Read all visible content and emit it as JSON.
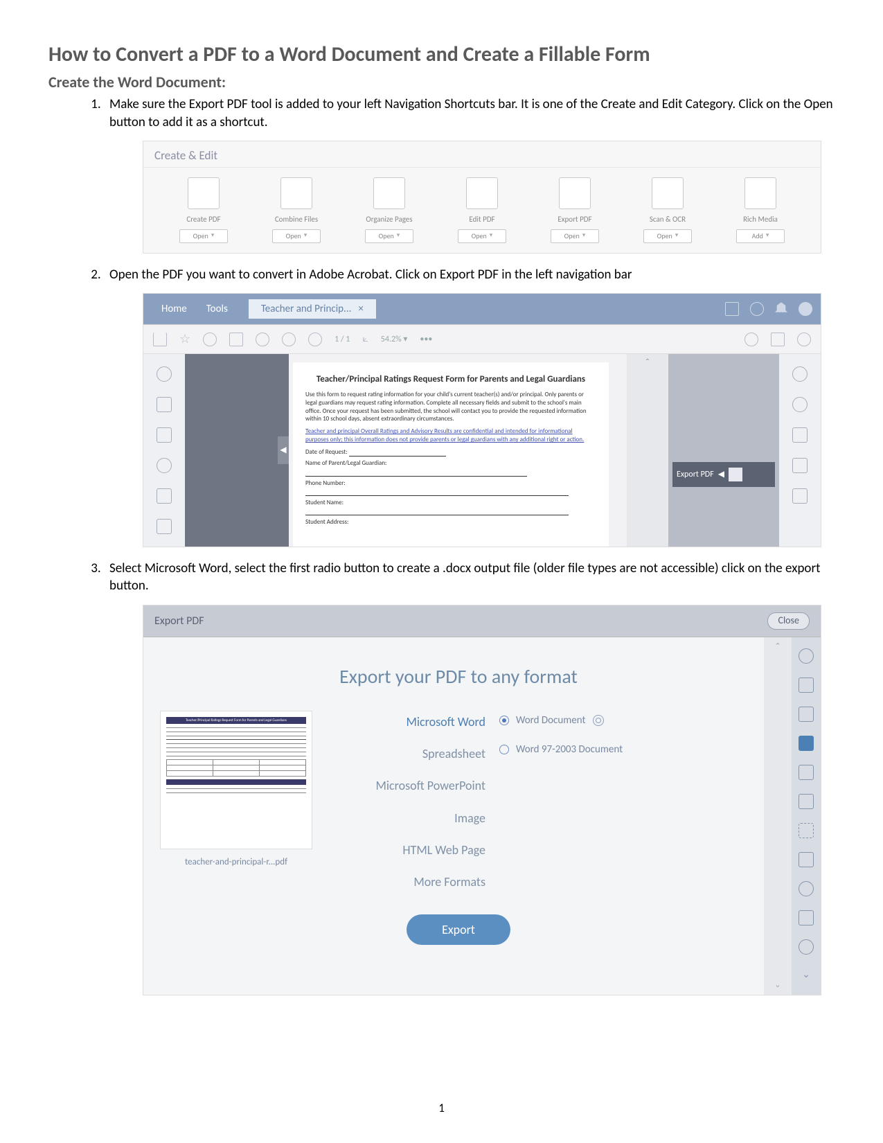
{
  "title": "How to Convert a PDF to a Word Document and Create a Fillable Form",
  "subtitle": "Create the Word Document:",
  "steps": {
    "s1": "Make sure the Export PDF tool is added to your left Navigation Shortcuts bar. It is one of the Create and Edit Category.  Click on the Open button to add it as a shortcut.",
    "s2": "Open the PDF you want to convert in Adobe Acrobat.  Click on Export PDF in the left navigation bar",
    "s3": "Select Microsoft Word, select the first radio button to create a .docx output file (older file types are not accessible) click on the export button."
  },
  "ss1": {
    "panel_title": "Create & Edit",
    "items": [
      {
        "label": "Create PDF",
        "btn": "Open"
      },
      {
        "label": "Combine Files",
        "btn": "Open"
      },
      {
        "label": "Organize Pages",
        "btn": "Open"
      },
      {
        "label": "Edit PDF",
        "btn": "Open"
      },
      {
        "label": "Export PDF",
        "btn": "Open"
      },
      {
        "label": "Scan & OCR",
        "btn": "Open"
      },
      {
        "label": "Rich Media",
        "btn": "Add"
      }
    ]
  },
  "ss2": {
    "tabs": {
      "home": "Home",
      "tools": "Tools",
      "doc": "Teacher and Princip...",
      "close_x": "×"
    },
    "toolbar": {
      "page": "1",
      "of": "/ 1",
      "zoom": "54.2%",
      "zoom_menu": "▾",
      "dots": "•••"
    },
    "doc": {
      "heading": "Teacher/Principal Ratings Request Form for Parents and Legal Guardians",
      "intro": "Use this form to request rating information for your child's current teacher(s) and/or principal. Only parents or legal guardians may request rating information. Complete all necessary fields and submit to the school's main office. Once your request has been submitted, the school will contact you to provide the requested information within 10 school days, absent extraordinary circumstances.",
      "underline": "Teacher and principal Overall Ratings and Advisory Results are confidential and intended for informational purposes only; this information does not provide parents or legal guardians with any additional right or action.",
      "f1": "Date of Request:",
      "f2": "Name of Parent/Legal Guardian:",
      "f3": "Phone Number:",
      "f4": "Student Name:",
      "f5": "Student Address:"
    },
    "export_label": "Export PDF"
  },
  "ss3": {
    "head": "Export PDF",
    "close": "Close",
    "title": "Export your PDF to any format",
    "thumb_caption": "teacher-and-principal-r...pdf",
    "formats": {
      "word": "Microsoft Word",
      "spreadsheet": "Spreadsheet",
      "ppt": "Microsoft PowerPoint",
      "image": "Image",
      "html": "HTML Web Page",
      "more": "More Formats"
    },
    "radios": {
      "docx": "Word Document",
      "doc": "Word 97-2003 Document"
    },
    "export_btn": "Export"
  },
  "page_number": "1"
}
